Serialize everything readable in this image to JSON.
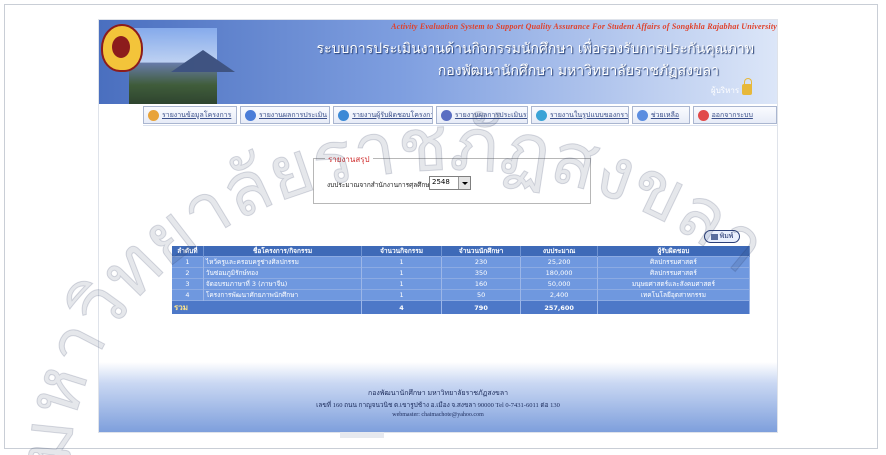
{
  "header": {
    "subtitle_en": "Activity Evaluation System to Support Quality Assurance For Student Affairs of Songkhla Rajabhat University",
    "title_th_1": "ระบบการประเมินงานด้านกิจกรรมนักศึกษา เพื่อรองรับการประกันคุณภาพ",
    "title_th_2": "กองพัฒนานักศึกษา มหาวิทยาลัยราชภัฏสงขลา",
    "admin_label": "ผู้บริหาร"
  },
  "menu": [
    {
      "label": "รายงานข้อมูลโครงการ",
      "icon": "report-icon",
      "color": "#e8a33a"
    },
    {
      "label": "รายงานผลการประเมิน",
      "icon": "globe-icon",
      "color": "#4a7dd8"
    },
    {
      "label": "รายงานผู้รับผิดชอบโครงการ",
      "icon": "globe-icon",
      "color": "#3d8ad6"
    },
    {
      "label": "รายงานผลการประเมินรวม",
      "icon": "people-icon",
      "color": "#5a6ec2"
    },
    {
      "label": "รายงานในรูปแบบของกราฟ",
      "icon": "chart-icon",
      "color": "#3aa3d6"
    },
    {
      "label": "ช่วยเหลือ",
      "icon": "help-icon",
      "color": "#5b8de0"
    },
    {
      "label": "ออกจากระบบ",
      "icon": "close-icon",
      "color": "#e14a4a"
    }
  ],
  "summary": {
    "legend": "รายงานสรุป",
    "budget_label": "งบประมาณจากสำนักงานการศุลศึกษา",
    "year": "2548"
  },
  "print_label": "พิมพ์",
  "table": {
    "headers": [
      "ลำดับที่",
      "ชื่อโครงการ/กิจกรรม",
      "จำนวนกิจกรรม",
      "จำนวนนักศึกษา",
      "งบประมาณ",
      "ผู้รับผิดชอบ"
    ],
    "rows": [
      [
        "1",
        "ไหว้ครูและครอบครูช่างศิลปกรรม",
        "1",
        "230",
        "25,200",
        "ศิลปกรรมศาสตร์"
      ],
      [
        "2",
        "วันซ่อมภูมิรักษ์ทอง",
        "1",
        "350",
        "180,000",
        "ศิลปกรรมศาสตร์"
      ],
      [
        "3",
        "จัดอบรมภาษาที่ 3 (ภาษาจีน)",
        "1",
        "160",
        "50,000",
        "มนุษยศาสตร์และสังคมศาสตร์"
      ],
      [
        "4",
        "โครงการพัฒนาศักยภาพนักศึกษา",
        "1",
        "50",
        "2,400",
        "เทคโนโลยีอุตสาหกรรม"
      ]
    ],
    "total": {
      "label": "รวม",
      "activities": "4",
      "students": "790",
      "budget": "257,600"
    }
  },
  "footer": {
    "line1": "กองพัฒนานักศึกษา มหาวิทยาลัยราชภัฏสงขลา",
    "line2": "เลขที่ 160 ถนน กาญจนวนิช ต.เขารูปช้าง อ.เมือง จ.สงขลา 90000 Tel 0-7431-6011 ต่อ 130",
    "line3": "webmaster: chaimachote@yahoo.com"
  },
  "watermark": "มหาวิทยาลัยราชภัฏสงขลา"
}
